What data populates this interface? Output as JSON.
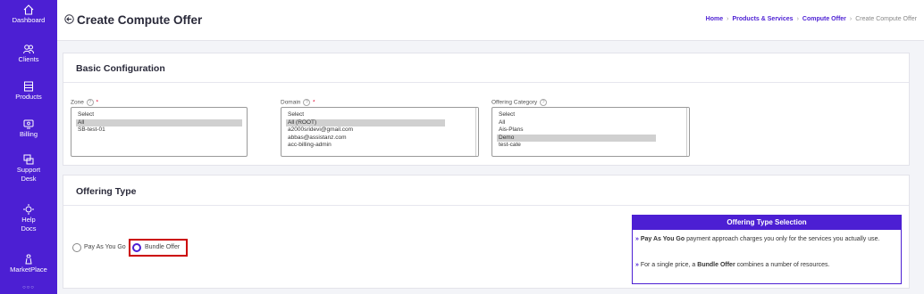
{
  "sidebar": {
    "items": [
      {
        "label": "Dashboard",
        "icon": "home-icon"
      },
      {
        "label": "Clients",
        "icon": "users-icon"
      },
      {
        "label": "Products",
        "icon": "server-icon"
      },
      {
        "label": "Billing",
        "icon": "billing-icon"
      },
      {
        "label": "Support Desk",
        "icon": "support-icon"
      },
      {
        "label": "Help Docs",
        "icon": "help-icon"
      },
      {
        "label": "MarketPlace",
        "icon": "marketplace-icon"
      }
    ]
  },
  "header": {
    "title": "Create Compute Offer",
    "breadcrumb": [
      "Home",
      "Products & Services",
      "Compute Offer",
      "Create Compute Offer"
    ]
  },
  "basic_config": {
    "title": "Basic Configuration",
    "zone": {
      "label": "Zone",
      "required_mark": "*",
      "help": "?",
      "options": [
        "Select",
        "All",
        "SB-test-01"
      ],
      "selected": "All"
    },
    "domain": {
      "label": "Domain",
      "required_mark": "*",
      "help": "?",
      "options": [
        "Select",
        "All (ROOT)",
        "a2000sridevi@gmail.com",
        "abbas@assistanz.com",
        "acc-billing-admin"
      ],
      "selected": "All (ROOT)"
    },
    "category": {
      "label": "Offering Category",
      "help": "?",
      "options": [
        "Select",
        "All",
        "Ais-Plans",
        "Demo",
        "test-cate"
      ],
      "selected": "Demo"
    }
  },
  "offering_type": {
    "title": "Offering Type",
    "options": [
      {
        "label": "Pay As You Go",
        "checked": false
      },
      {
        "label": "Bundle Offer",
        "checked": true
      }
    ],
    "info": {
      "title": "Offering Type Selection",
      "line1_arrow": "»",
      "line1_bold": "Pay As You Go",
      "line1_rest": " payment approach charges you only for the services you actually use.",
      "line2_arrow": "»",
      "line2_pre": " For a single price, a ",
      "line2_bold": "Bundle Offer",
      "line2_rest": " combines a number of resources."
    }
  },
  "colors": {
    "accent": "#4c1fd3",
    "highlight": "#cc0000",
    "required": "#e0002a"
  }
}
